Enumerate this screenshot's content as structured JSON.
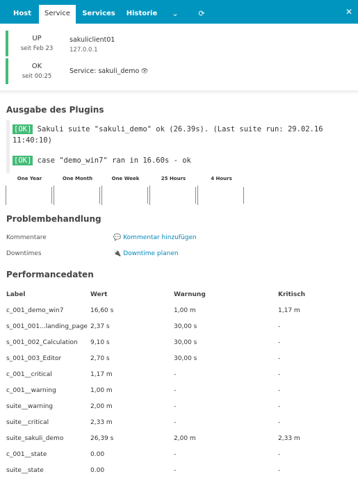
{
  "tabs": [
    {
      "label": "Host",
      "active": false
    },
    {
      "label": "Service",
      "active": true
    },
    {
      "label": "Services",
      "active": false
    },
    {
      "label": "Historie",
      "active": false
    }
  ],
  "tab_icons": {
    "dropdown": "⌄",
    "refresh": "⟳",
    "close": "✕"
  },
  "colors": {
    "accent": "#0095bf",
    "ok": "#44bb77"
  },
  "host_status": {
    "state": "UP",
    "since": "seit Feb 23",
    "name": "sakuliclient01",
    "address": "127.0.0.1"
  },
  "service_status": {
    "state": "OK",
    "since": "seit 00:25",
    "name": "Service: sakuli_demo",
    "icon": "eye-slash-icon"
  },
  "plugin_output": {
    "title": "Ausgabe des Plugins",
    "lines": [
      {
        "badge": "[OK]",
        "text": " Sakuli suite \"sakuli_demo\" ok (26.39s). (Last suite run: 29.02.16 11:40:10)"
      },
      {
        "badge": "[OK]",
        "text": " case \"demo_win7\" ran in 16.60s - ok"
      }
    ]
  },
  "graphs": [
    "One Year",
    "One Month",
    "One Week",
    "25 Hours",
    "4 Hours"
  ],
  "problem_handling": {
    "title": "Problembehandlung",
    "comments_label": "Kommentare",
    "comments_action": "Kommentar hinzufügen",
    "downtimes_label": "Downtimes",
    "downtimes_action": "Downtime planen"
  },
  "performance": {
    "title": "Performancedaten",
    "headers": [
      "Label",
      "Wert",
      "Warnung",
      "Kritisch"
    ],
    "rows": [
      [
        "c_001_demo_win7",
        "16,60 s",
        "1,00 m",
        "1,17 m"
      ],
      [
        "s_001_001...landing_page",
        "2,37 s",
        "30,00 s",
        "-"
      ],
      [
        "s_001_002_Calculation",
        "9,10 s",
        "30,00 s",
        "-"
      ],
      [
        "s_001_003_Editor",
        "2,70 s",
        "30,00 s",
        "-"
      ],
      [
        "c_001__critical",
        "1,17 m",
        "-",
        "-"
      ],
      [
        "c_001__warning",
        "1,00 m",
        "-",
        "-"
      ],
      [
        "suite__warning",
        "2,00 m",
        "-",
        "-"
      ],
      [
        "suite__critical",
        "2,33 m",
        "-",
        "-"
      ],
      [
        "suite_sakuli_demo",
        "26,39 s",
        "2,00 m",
        "2,33 m"
      ],
      [
        "c_001__state",
        "0.00",
        "-",
        "-"
      ],
      [
        "suite__state",
        "0.00",
        "-",
        "-"
      ]
    ]
  }
}
